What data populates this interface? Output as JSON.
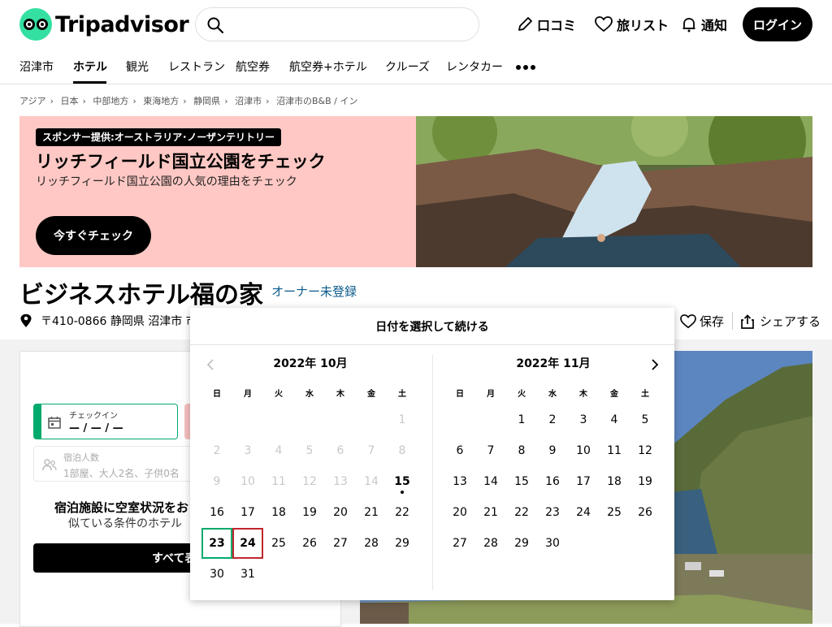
{
  "header": {
    "logo_text": "Tripadvisor",
    "search": {
      "placeholder": "",
      "value": ""
    },
    "review_label": "口コミ",
    "trips_label": "旅リスト",
    "notify_label": "通知",
    "login_label": "ログイン"
  },
  "nav": {
    "items": [
      "沼津市",
      "ホテル",
      "観光",
      "レストラン",
      "航空券",
      "航空券+ホテル",
      "クルーズ",
      "レンタカー"
    ],
    "active": "ホテル"
  },
  "breadcrumb": [
    "アジア",
    "日本",
    "中部地方",
    "東海地方",
    "静岡県",
    "沼津市",
    "沼津市のB&B / イン"
  ],
  "banner": {
    "sponsor": "スポンサー提供:オーストラリア･ノーザンテリトリー",
    "title": "リッチフィールド国立公園をチェック",
    "subtitle": "リッチフィールド国立公園の人気の理由をチェック",
    "button": "今すぐチェック"
  },
  "hotel": {
    "name": "ビジネスホテル福の家",
    "owner_link": "オーナー未登録",
    "address": "〒410-0866 静岡県 沼津市 市",
    "save_label": "保存",
    "share_label": "シェアする"
  },
  "booking": {
    "checkin_label": "チェックイン",
    "checkin_value": "— / — / —",
    "guests_label": "宿泊人数",
    "guests_value": "1部屋、大人2名、子供0名",
    "avail_line1": "宿泊施設に空室状況をお",
    "avail_line2": "似ている条件のホテル",
    "all_button": "すべて表"
  },
  "calendar": {
    "title": "日付を選択して続ける",
    "weekdays": [
      "日",
      "月",
      "火",
      "水",
      "木",
      "金",
      "土"
    ],
    "months": [
      {
        "label": "2022年 10月",
        "weeks": [
          [
            "",
            "",
            "",
            "",
            "",
            "",
            "1"
          ],
          [
            "2",
            "3",
            "4",
            "5",
            "6",
            "7",
            "8"
          ],
          [
            "9",
            "10",
            "11",
            "12",
            "13",
            "14",
            "15"
          ],
          [
            "16",
            "17",
            "18",
            "19",
            "20",
            "21",
            "22"
          ],
          [
            "23",
            "24",
            "25",
            "26",
            "27",
            "28",
            "29"
          ],
          [
            "30",
            "31",
            "",
            "",
            "",
            "",
            ""
          ]
        ]
      },
      {
        "label": "2022年 11月",
        "weeks": [
          [
            "",
            "",
            "1",
            "2",
            "3",
            "4",
            "5"
          ],
          [
            "6",
            "7",
            "8",
            "9",
            "10",
            "11",
            "12"
          ],
          [
            "13",
            "14",
            "15",
            "16",
            "17",
            "18",
            "19"
          ],
          [
            "20",
            "21",
            "22",
            "23",
            "24",
            "25",
            "26"
          ],
          [
            "27",
            "28",
            "29",
            "30",
            "",
            "",
            ""
          ]
        ]
      }
    ],
    "today": "15",
    "checkin_day": "23",
    "checkout_day": "24",
    "colors": {
      "checkin": "#00aa6c",
      "checkout": "#c0272d",
      "past": "#c8c8c8"
    }
  }
}
